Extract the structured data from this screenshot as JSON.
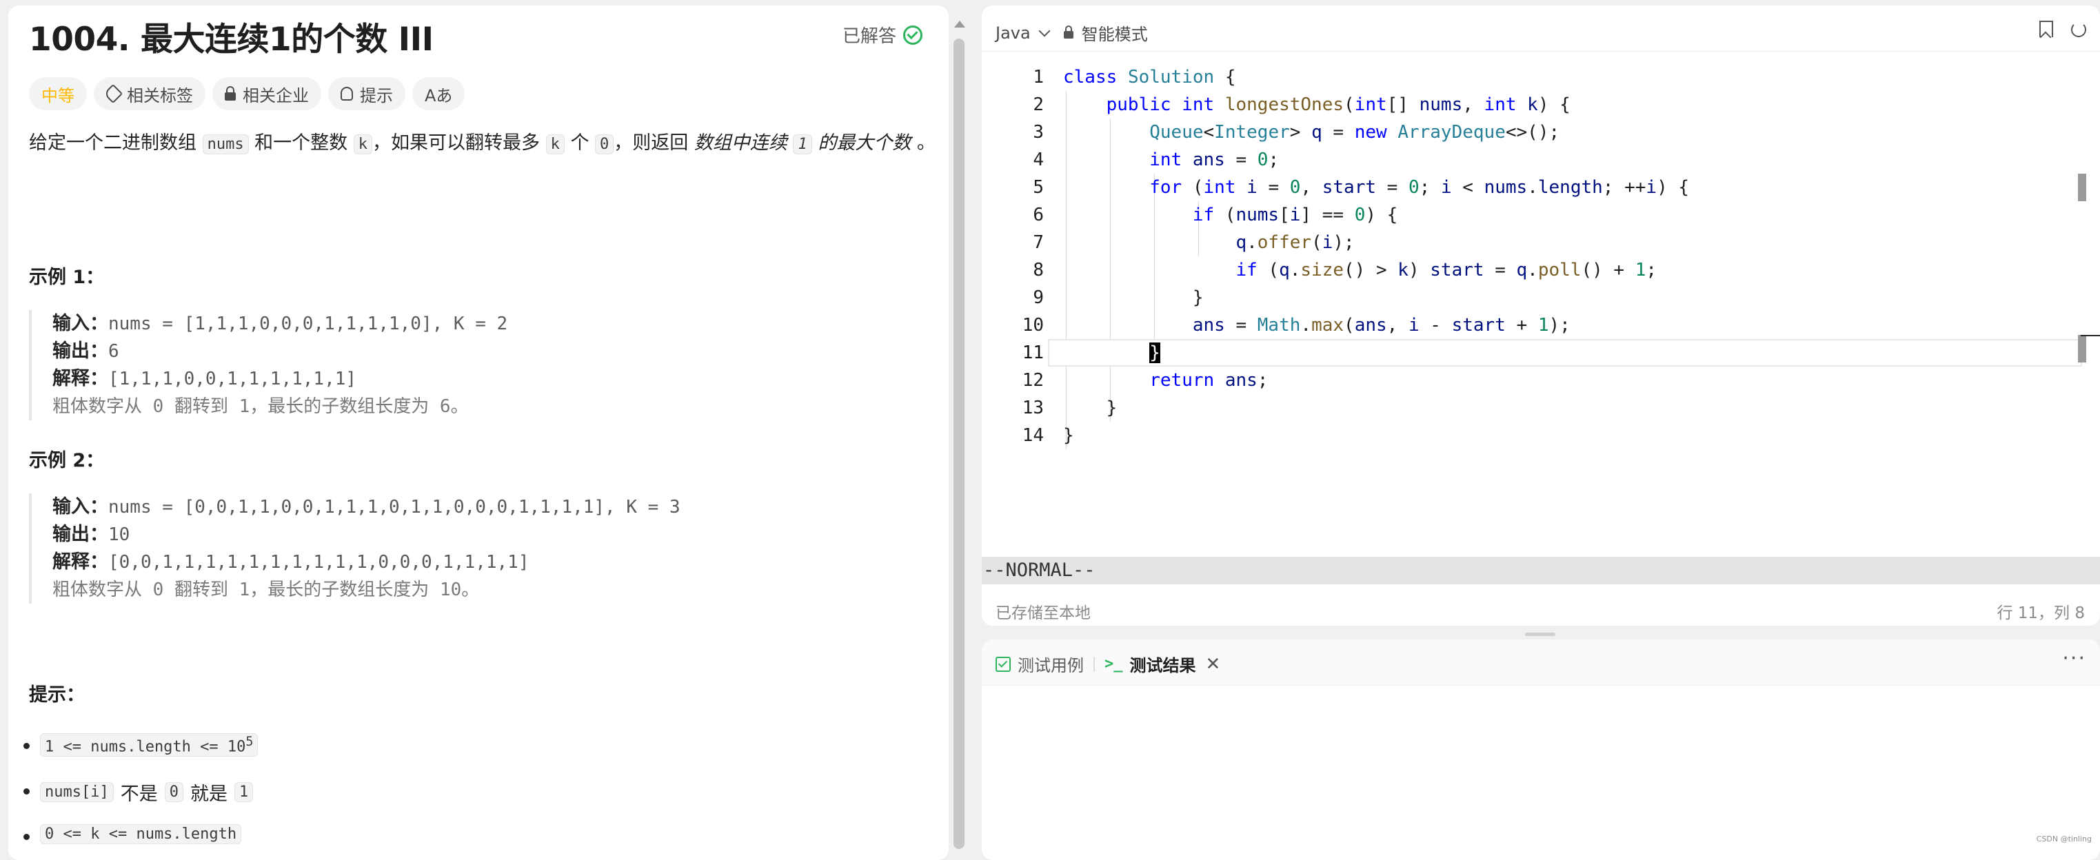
{
  "problem": {
    "title": "1004. 最大连续1的个数 III",
    "solved_label": "已解答",
    "tags": [
      {
        "label": "中等"
      },
      {
        "label": "相关标签"
      },
      {
        "label": "相关企业"
      },
      {
        "label": "提示"
      },
      {
        "label": "Aあ"
      }
    ],
    "desc": {
      "p1": "给定一个二进制数组",
      "nums": "nums",
      "p2": "和一个整数",
      "k": "k",
      "p3": "，如果可以翻转最多",
      "k2": "k",
      "p4": "个",
      "zero": "0",
      "p5": "，则返回",
      "emph1": "数组中连续",
      "one": "1",
      "emph2": "的最大个数",
      "end": "。"
    },
    "examples": [
      {
        "heading": "示例 1：",
        "input_label": "输入：",
        "input_value": "nums = [1,1,1,0,0,0,1,1,1,1,0], K = 2",
        "output_label": "输出：",
        "output_value": "6",
        "explain_label": "解释：",
        "explain_value": "[1,1,1,0,0,1,1,1,1,1,1]",
        "note": "粗体数字从 0 翻转到 1，最长的子数组长度为 6。"
      },
      {
        "heading": "示例 2：",
        "input_label": "输入：",
        "input_value": "nums = [0,0,1,1,0,0,1,1,1,0,1,1,0,0,0,1,1,1,1], K = 3",
        "output_label": "输出：",
        "output_value": "10",
        "explain_label": "解释：",
        "explain_value": "[0,0,1,1,1,1,1,1,1,1,1,1,0,0,0,1,1,1,1]",
        "note": "粗体数字从 0 翻转到 1，最长的子数组长度为 10。"
      }
    ],
    "hints_heading": "提示：",
    "hints": {
      "h1": "1 <= nums.length <= 10",
      "h1_sup": "5",
      "h2_code": "nums[i]",
      "h2_mid": "不是",
      "h2_zero": "0",
      "h2_and": "就是",
      "h2_one": "1",
      "h3": "0 <= k <= nums.length"
    }
  },
  "editor": {
    "language": "Java",
    "mode": "智能模式",
    "line_numbers": [
      "1",
      "2",
      "3",
      "4",
      "5",
      "6",
      "7",
      "8",
      "9",
      "10",
      "11",
      "12",
      "13",
      "14"
    ],
    "vim_mode": "--NORMAL--",
    "saved_status": "已存储至本地",
    "cursor_pos": "行 11，列 8"
  },
  "results": {
    "tab_testcase": "测试用例",
    "tab_result": "测试结果",
    "more": "···"
  },
  "watermark": "CSDN @tinling",
  "colors": {
    "easy_medium": "#ffb800",
    "success": "#2db55d",
    "keyword": "#0000ff",
    "type": "#267f99",
    "function": "#795e26",
    "number": "#098658"
  }
}
